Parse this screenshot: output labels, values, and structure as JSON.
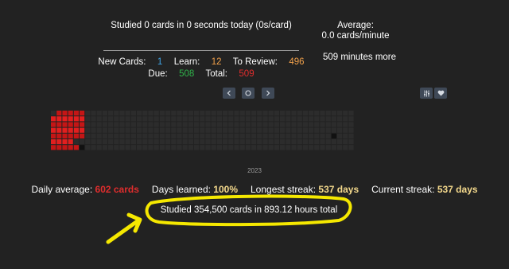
{
  "header": {
    "studied_today": "Studied 0 cards in 0 seconds today (0s/card)",
    "average_label": "Average:",
    "average_value": "0.0 cards/minute",
    "minutes_more": "509 minutes more"
  },
  "counts": {
    "new_label": "New Cards:",
    "new_value": "1",
    "learn_label": "Learn:",
    "learn_value": "12",
    "review_label": "To Review:",
    "review_value": "496",
    "due_label": "Due:",
    "due_value": "508",
    "total_label": "Total:",
    "total_value": "509"
  },
  "icons": {
    "prev": "chevron-left-icon",
    "today": "circle-icon",
    "next": "chevron-right-icon",
    "filter": "sliders-icon",
    "favorite": "heart-icon"
  },
  "heatmap": {
    "year_label": "2023",
    "colors": {
      "empty": "#2c2c2c",
      "studied": "#e31f1f",
      "studied_dark": "#c41616",
      "today": "#111111"
    },
    "week_count": 53,
    "days_per_week": 7,
    "studied_cells": [
      [
        0,
        1
      ],
      [
        0,
        2
      ],
      [
        0,
        3
      ],
      [
        0,
        4
      ],
      [
        0,
        5
      ],
      [
        0,
        6
      ],
      [
        1,
        0
      ],
      [
        1,
        1
      ],
      [
        1,
        2
      ],
      [
        1,
        3
      ],
      [
        1,
        4
      ],
      [
        1,
        5
      ],
      [
        1,
        6
      ],
      [
        2,
        0
      ],
      [
        2,
        1
      ],
      [
        2,
        2
      ],
      [
        2,
        3
      ],
      [
        2,
        4
      ],
      [
        2,
        5
      ],
      [
        2,
        6
      ],
      [
        3,
        0
      ],
      [
        3,
        1
      ],
      [
        3,
        2
      ],
      [
        3,
        3
      ],
      [
        3,
        4
      ],
      [
        3,
        5
      ],
      [
        3,
        6
      ],
      [
        4,
        0
      ],
      [
        4,
        1
      ],
      [
        4,
        2
      ],
      [
        4,
        3
      ],
      [
        4,
        4
      ],
      [
        4,
        6
      ],
      [
        5,
        0
      ],
      [
        5,
        1
      ],
      [
        5,
        2
      ],
      [
        5,
        3
      ],
      [
        5,
        4
      ]
    ],
    "today_cell": [
      5,
      6
    ],
    "dark_cells": [
      [
        49,
        4
      ]
    ]
  },
  "stats": {
    "daily_label": "Daily average:",
    "daily_value": "602 cards",
    "learned_label": "Days learned:",
    "learned_value": "100%",
    "longest_label": "Longest streak:",
    "longest_value": "537 days",
    "current_label": "Current streak:",
    "current_value": "537 days",
    "total_text": "Studied 354,500 cards in 893.12 hours total"
  },
  "colors": {
    "blue": "#3fa3e6",
    "orange": "#f0a04b",
    "green": "#2fb34a",
    "red": "#e02d2d",
    "gold": "#f4d98c",
    "highlight": "#f5e800"
  }
}
